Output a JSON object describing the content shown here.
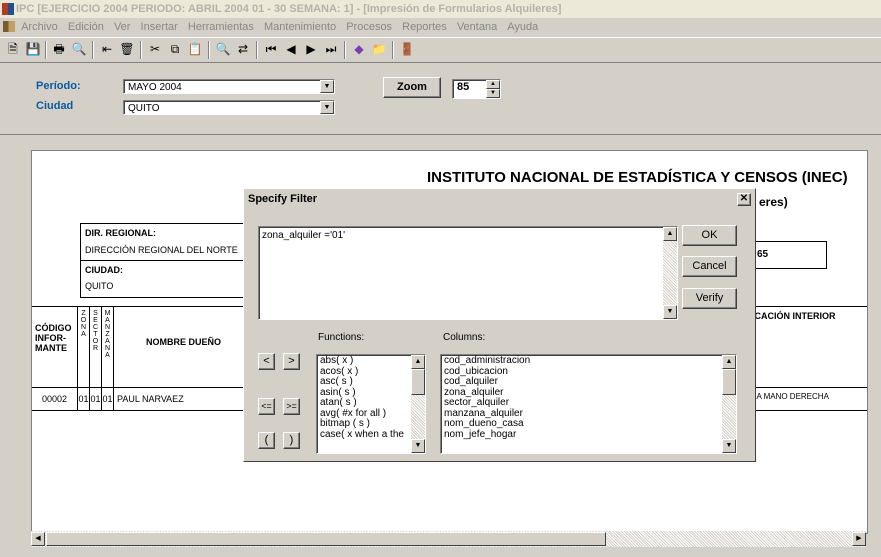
{
  "window": {
    "title": "IPC [EJERCICIO 2004 PERIODO: ABRIL 2004 01 - 30 SEMANA: 1] - [Impresión de Formularios Alquileres]"
  },
  "menu": [
    "Archivo",
    "Edición",
    "Ver",
    "Insertar",
    "Herramientas",
    "Mantenimiento",
    "Procesos",
    "Reportes",
    "Ventana",
    "Ayuda"
  ],
  "toolbar": {
    "icons": [
      "new-icon",
      "save-icon",
      "print-icon",
      "print-preview-icon",
      "insert-row-icon",
      "delete-icon",
      "cut-icon",
      "copy-icon",
      "paste-icon",
      "find-icon",
      "replace-icon",
      "first-record-icon",
      "previous-record-icon",
      "next-record-icon",
      "last-record-icon",
      "edit-icon",
      "folder-icon",
      "exit-icon"
    ]
  },
  "header": {
    "periodo_label": "Período:",
    "periodo_value": "MAYO 2004",
    "ciudad_label": "Ciudad",
    "ciudad_value": "QUITO",
    "zoom_label": "Zoom",
    "zoom_value": "85"
  },
  "report": {
    "institute": "INSTITUTO NACIONAL DE ESTADÍSTICA Y CENSOS  (INEC)",
    "subtitle_fragment": "eres)",
    "dir_regional_label": "DIR. REGIONAL:",
    "dir_regional_value": "DIRECCIÓN REGIONAL DEL NORTE",
    "ciudad_label": "CIUDAD:",
    "ciudad_value": "QUITO",
    "box_value": "65",
    "col_codigo": "CÓDIGO INFOR- MANTE",
    "col_zona": "Z O N A",
    "col_sector": "S E C T O R",
    "col_manzana": "M A N Z A N A",
    "col_nombre": "NOMBRE DUEÑO",
    "col_ubicacion": "ICACIÓN INTERIOR",
    "row": {
      "codigo": "00002",
      "zona": "01",
      "sector": "01",
      "manzana": "01",
      "nombre": "PAUL NARVAEZ",
      "ubicacion": "LA MANO DERECHA"
    }
  },
  "dialog": {
    "title": "Specify Filter",
    "expression": "zona_alquiler ='01'",
    "ok": "OK",
    "cancel": "Cancel",
    "verify": "Verify",
    "functions_label": "Functions:",
    "columns_label": "Columns:",
    "op_lt": "<",
    "op_gt": ">",
    "op_le": "<=",
    "op_ge": ">=",
    "op_lparen": "(",
    "op_rparen": ")",
    "functions": [
      "abs( x )",
      "acos( x )",
      "asc( s )",
      "asin( s )",
      "atan( s )",
      "avg( #x for all )",
      "bitmap ( s )",
      "case( x when a the"
    ],
    "columns": [
      "cod_administracion",
      "cod_ubicacion",
      "cod_alquiler",
      "zona_alquiler",
      "sector_alquiler",
      "manzana_alquiler",
      "nom_dueno_casa",
      "nom_jefe_hogar"
    ]
  }
}
